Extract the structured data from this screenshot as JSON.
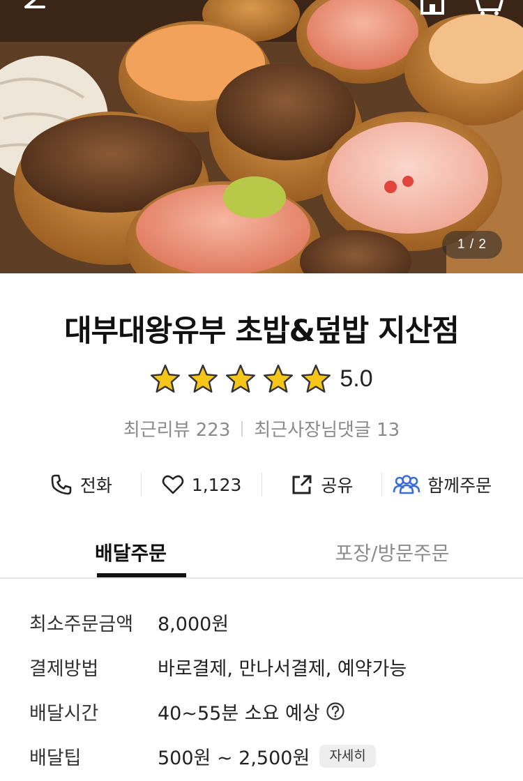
{
  "hero": {
    "image_counter": "1 / 2"
  },
  "store": {
    "name": "대부대왕유부 초밥&덮밥 지산점",
    "rating": 5.0,
    "rating_text": "5.0",
    "reviews_label": "최근리뷰 223",
    "owner_replies_label": "최근사장님댓글 13"
  },
  "actions": {
    "call_label": "전화",
    "likes_count": "1,123",
    "share_label": "공유",
    "group_order_label": "함께주문"
  },
  "tabs": [
    {
      "label": "배달주문",
      "active": true
    },
    {
      "label": "포장/방문주문",
      "active": false
    }
  ],
  "info": {
    "min_order": {
      "label": "최소주문금액",
      "value": "8,000원"
    },
    "payment": {
      "label": "결제방법",
      "value": "바로결제, 만나서결제, 예약가능"
    },
    "delivery_time": {
      "label": "배달시간",
      "value": "40~55분 소요 예상"
    },
    "delivery_tip": {
      "label": "배달팁",
      "value": "500원 ~ 2,500원",
      "button": "자세히"
    }
  },
  "colors": {
    "star": "#f5c518",
    "accent_blue": "#3a6bd8",
    "text_muted": "#8a8a8a"
  }
}
